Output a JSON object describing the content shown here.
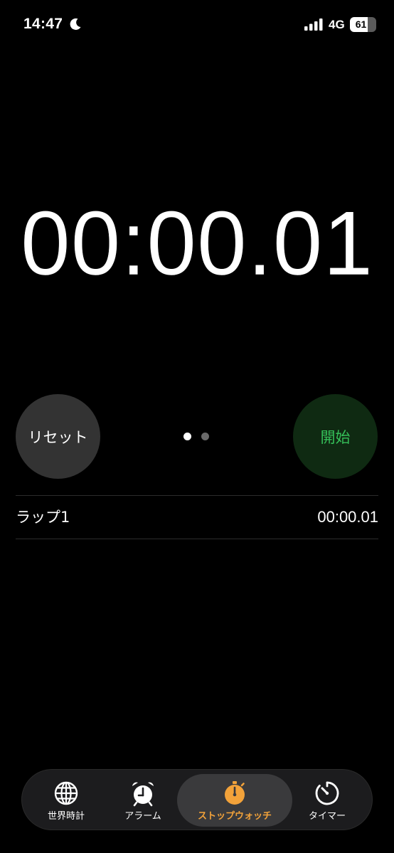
{
  "status_bar": {
    "time": "14:47",
    "network": "4G",
    "battery": "61",
    "battery_level": 0.61
  },
  "stopwatch": {
    "display": "00:00.01",
    "reset_label": "リセット",
    "start_label": "開始",
    "start_color": "#35c059"
  },
  "laps": [
    {
      "label": "ラップ1",
      "time": "00:00.01"
    }
  ],
  "tabs": [
    {
      "label": "世界時計",
      "icon": "globe-icon"
    },
    {
      "label": "アラーム",
      "icon": "alarm-clock-icon"
    },
    {
      "label": "ストップウォッチ",
      "icon": "stopwatch-icon",
      "active": true,
      "color": "#f2a23a"
    },
    {
      "label": "タイマー",
      "icon": "timer-icon"
    }
  ]
}
